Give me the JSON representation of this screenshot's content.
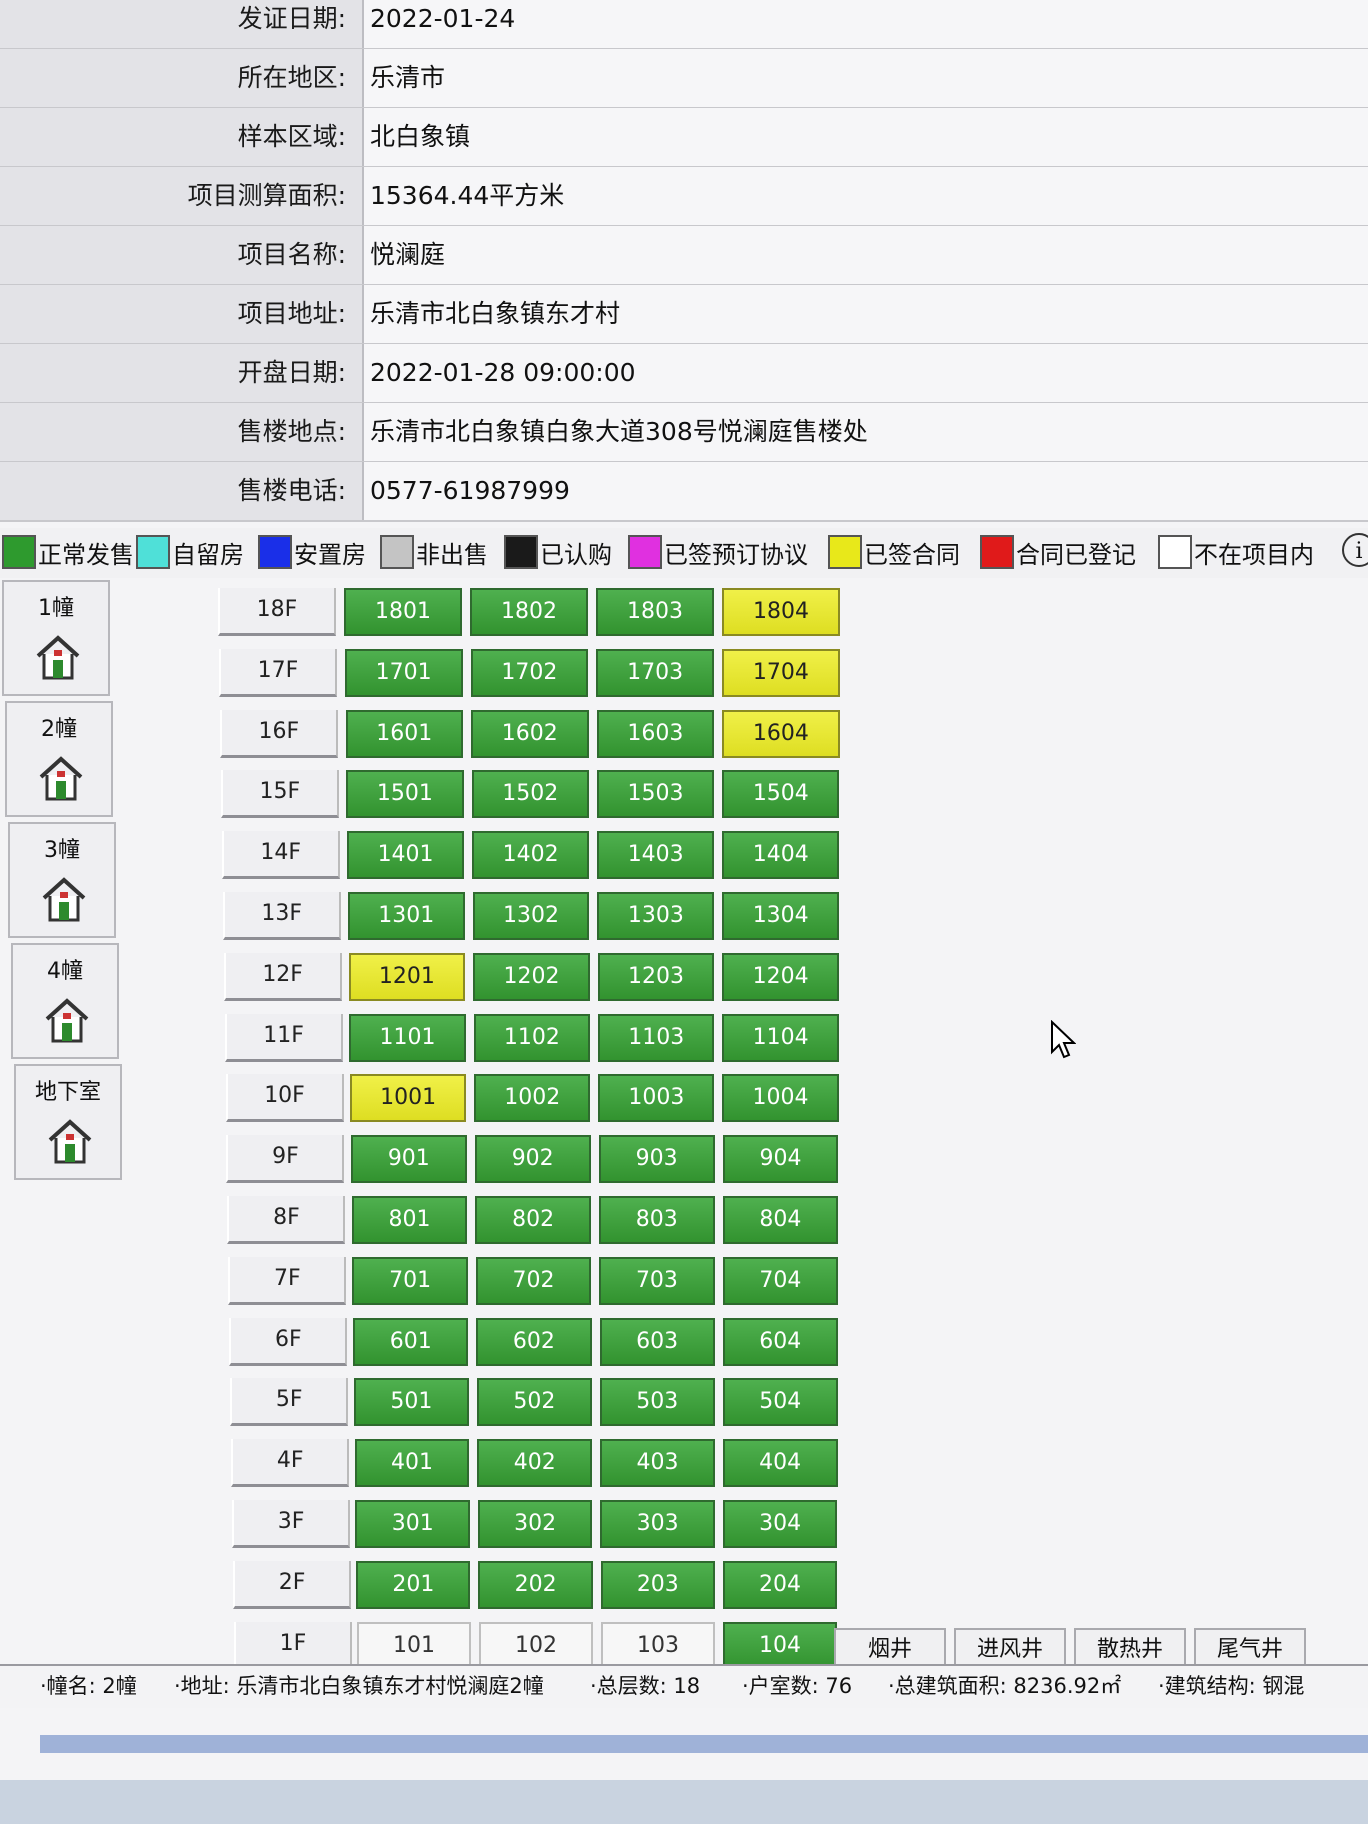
{
  "info": [
    {
      "label": "发证日期:",
      "value": "2022-01-24"
    },
    {
      "label": "所在地区:",
      "value": "乐清市"
    },
    {
      "label": "样本区域:",
      "value": "北白象镇"
    },
    {
      "label": "项目测算面积:",
      "value": "15364.44平方米"
    },
    {
      "label": "项目名称:",
      "value": "悦澜庭"
    },
    {
      "label": "项目地址:",
      "value": "乐清市北白象镇东才村"
    },
    {
      "label": "开盘日期:",
      "value": "2022-01-28 09:00:00"
    },
    {
      "label": "售楼地点:",
      "value": "乐清市北白象镇白象大道308号悦澜庭售楼处"
    },
    {
      "label": "售楼电话:",
      "value": "0577-61987999"
    }
  ],
  "legend": [
    {
      "label": "正常发售",
      "color": "#2e9a2e"
    },
    {
      "label": "自留房",
      "color": "#4fe0d8"
    },
    {
      "label": "安置房",
      "color": "#1a2fe8"
    },
    {
      "label": "非出售",
      "color": "#c4c4c4"
    },
    {
      "label": "已认购",
      "color": "#1a1a1a"
    },
    {
      "label": "已签预订协议",
      "color": "#e030e0"
    },
    {
      "label": "已签合同",
      "color": "#e8e81a"
    },
    {
      "label": "合同已登记",
      "color": "#e01a1a"
    },
    {
      "label": "不在项目内",
      "color": "#ffffff"
    }
  ],
  "buildings": [
    "1幢",
    "2幢",
    "3幢",
    "4幢",
    "地下室"
  ],
  "floors": [
    {
      "floor": "18F",
      "units": [
        {
          "no": "1801",
          "status": "green"
        },
        {
          "no": "1802",
          "status": "green"
        },
        {
          "no": "1803",
          "status": "green"
        },
        {
          "no": "1804",
          "status": "yellow"
        }
      ]
    },
    {
      "floor": "17F",
      "units": [
        {
          "no": "1701",
          "status": "green"
        },
        {
          "no": "1702",
          "status": "green"
        },
        {
          "no": "1703",
          "status": "green"
        },
        {
          "no": "1704",
          "status": "yellow"
        }
      ]
    },
    {
      "floor": "16F",
      "units": [
        {
          "no": "1601",
          "status": "green"
        },
        {
          "no": "1602",
          "status": "green"
        },
        {
          "no": "1603",
          "status": "green"
        },
        {
          "no": "1604",
          "status": "yellow"
        }
      ]
    },
    {
      "floor": "15F",
      "units": [
        {
          "no": "1501",
          "status": "green"
        },
        {
          "no": "1502",
          "status": "green"
        },
        {
          "no": "1503",
          "status": "green"
        },
        {
          "no": "1504",
          "status": "green"
        }
      ]
    },
    {
      "floor": "14F",
      "units": [
        {
          "no": "1401",
          "status": "green"
        },
        {
          "no": "1402",
          "status": "green"
        },
        {
          "no": "1403",
          "status": "green"
        },
        {
          "no": "1404",
          "status": "green"
        }
      ]
    },
    {
      "floor": "13F",
      "units": [
        {
          "no": "1301",
          "status": "green"
        },
        {
          "no": "1302",
          "status": "green"
        },
        {
          "no": "1303",
          "status": "green"
        },
        {
          "no": "1304",
          "status": "green"
        }
      ]
    },
    {
      "floor": "12F",
      "units": [
        {
          "no": "1201",
          "status": "yellow"
        },
        {
          "no": "1202",
          "status": "green"
        },
        {
          "no": "1203",
          "status": "green"
        },
        {
          "no": "1204",
          "status": "green"
        }
      ]
    },
    {
      "floor": "11F",
      "units": [
        {
          "no": "1101",
          "status": "green"
        },
        {
          "no": "1102",
          "status": "green"
        },
        {
          "no": "1103",
          "status": "green"
        },
        {
          "no": "1104",
          "status": "green"
        }
      ]
    },
    {
      "floor": "10F",
      "units": [
        {
          "no": "1001",
          "status": "yellow"
        },
        {
          "no": "1002",
          "status": "green"
        },
        {
          "no": "1003",
          "status": "green"
        },
        {
          "no": "1004",
          "status": "green"
        }
      ]
    },
    {
      "floor": "9F",
      "units": [
        {
          "no": "901",
          "status": "green"
        },
        {
          "no": "902",
          "status": "green"
        },
        {
          "no": "903",
          "status": "green"
        },
        {
          "no": "904",
          "status": "green"
        }
      ]
    },
    {
      "floor": "8F",
      "units": [
        {
          "no": "801",
          "status": "green"
        },
        {
          "no": "802",
          "status": "green"
        },
        {
          "no": "803",
          "status": "green"
        },
        {
          "no": "804",
          "status": "green"
        }
      ]
    },
    {
      "floor": "7F",
      "units": [
        {
          "no": "701",
          "status": "green"
        },
        {
          "no": "702",
          "status": "green"
        },
        {
          "no": "703",
          "status": "green"
        },
        {
          "no": "704",
          "status": "green"
        }
      ]
    },
    {
      "floor": "6F",
      "units": [
        {
          "no": "601",
          "status": "green"
        },
        {
          "no": "602",
          "status": "green"
        },
        {
          "no": "603",
          "status": "green"
        },
        {
          "no": "604",
          "status": "green"
        }
      ]
    },
    {
      "floor": "5F",
      "units": [
        {
          "no": "501",
          "status": "green"
        },
        {
          "no": "502",
          "status": "green"
        },
        {
          "no": "503",
          "status": "green"
        },
        {
          "no": "504",
          "status": "green"
        }
      ]
    },
    {
      "floor": "4F",
      "units": [
        {
          "no": "401",
          "status": "green"
        },
        {
          "no": "402",
          "status": "green"
        },
        {
          "no": "403",
          "status": "green"
        },
        {
          "no": "404",
          "status": "green"
        }
      ]
    },
    {
      "floor": "3F",
      "units": [
        {
          "no": "301",
          "status": "green"
        },
        {
          "no": "302",
          "status": "green"
        },
        {
          "no": "303",
          "status": "green"
        },
        {
          "no": "304",
          "status": "green"
        }
      ]
    },
    {
      "floor": "2F",
      "units": [
        {
          "no": "201",
          "status": "green"
        },
        {
          "no": "202",
          "status": "green"
        },
        {
          "no": "203",
          "status": "green"
        },
        {
          "no": "204",
          "status": "green"
        }
      ]
    },
    {
      "floor": "1F",
      "units": [
        {
          "no": "101",
          "status": "white"
        },
        {
          "no": "102",
          "status": "white"
        },
        {
          "no": "103",
          "status": "white"
        },
        {
          "no": "104",
          "status": "green"
        }
      ]
    }
  ],
  "shafts": [
    "烟井",
    "进风井",
    "散热井",
    "尾气井"
  ],
  "statusbar": {
    "name": "·幢名: 2幢",
    "address": "·地址: 乐清市北白象镇东才村悦澜庭2幢",
    "floors": "·总层数: 18",
    "units": "·户室数: 76",
    "area": "·总建筑面积: 8236.92㎡",
    "structure": "·建筑结构: 钢混"
  }
}
